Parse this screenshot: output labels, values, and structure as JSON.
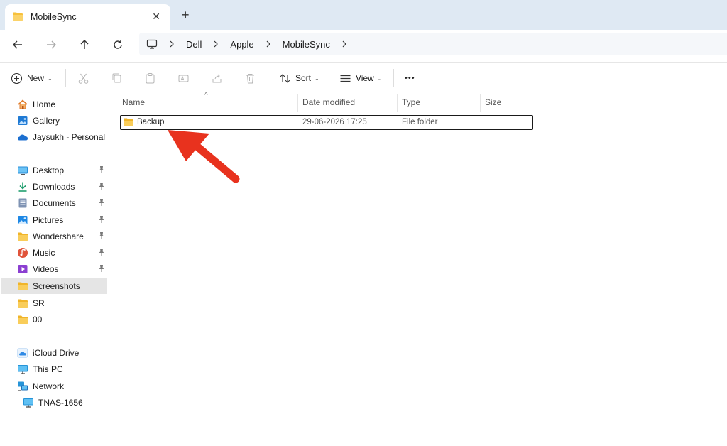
{
  "tab": {
    "title": "MobileSync",
    "close_glyph": "✕",
    "new_tab_glyph": "+"
  },
  "address": {
    "breadcrumbs": [
      "Dell",
      "Apple",
      "MobileSync"
    ]
  },
  "toolbar": {
    "new_label": "New",
    "sort_label": "Sort",
    "view_label": "View",
    "more_glyph": "•••",
    "caret": "⌄"
  },
  "sidebar": {
    "quick": [
      {
        "label": "Home",
        "icon": "home-icon"
      },
      {
        "label": "Gallery",
        "icon": "gallery-icon"
      },
      {
        "label": "Jaysukh - Personal",
        "icon": "onedrive-icon"
      }
    ],
    "pinned": [
      {
        "label": "Desktop",
        "icon": "desktop-icon",
        "pinned": true
      },
      {
        "label": "Downloads",
        "icon": "downloads-icon",
        "pinned": true
      },
      {
        "label": "Documents",
        "icon": "documents-icon",
        "pinned": true
      },
      {
        "label": "Pictures",
        "icon": "pictures-icon",
        "pinned": true
      },
      {
        "label": "Wondershare",
        "icon": "folder-icon",
        "pinned": true
      },
      {
        "label": "Music",
        "icon": "music-icon",
        "pinned": true
      },
      {
        "label": "Videos",
        "icon": "videos-icon",
        "pinned": true
      },
      {
        "label": "Screenshots",
        "icon": "folder-icon",
        "selected": true
      },
      {
        "label": "SR",
        "icon": "folder-icon"
      },
      {
        "label": "00",
        "icon": "folder-icon"
      }
    ],
    "locations": [
      {
        "label": "iCloud Drive",
        "icon": "icloud-icon"
      },
      {
        "label": "This PC",
        "icon": "this-pc-icon"
      },
      {
        "label": "Network",
        "icon": "network-icon"
      },
      {
        "label": "TNAS-1656",
        "icon": "nas-icon"
      }
    ]
  },
  "columns": {
    "name": "Name",
    "date": "Date modified",
    "type": "Type",
    "size": "Size",
    "sort_glyph": "^"
  },
  "files": [
    {
      "name": "Backup",
      "date": "29-06-2026 17:25",
      "type": "File folder",
      "size": ""
    }
  ],
  "colors": {
    "accent": "#0067c0",
    "folder": "#f7c13c",
    "annotation_arrow": "#e8321e",
    "tabbar_bg": "#dfe9f3"
  }
}
